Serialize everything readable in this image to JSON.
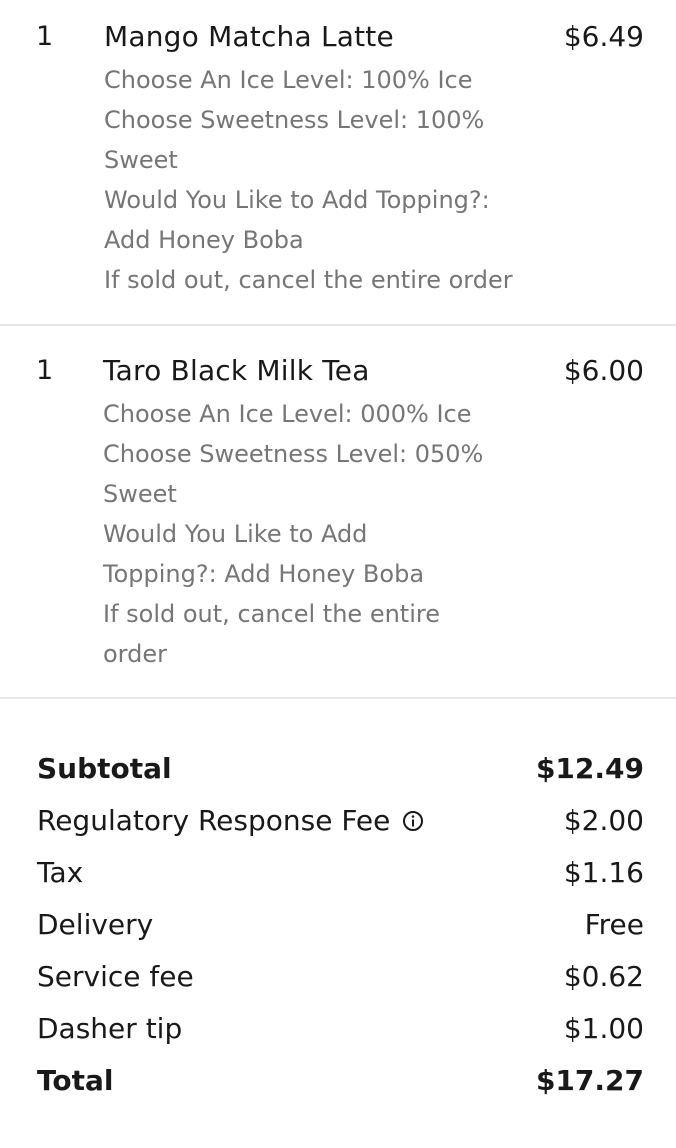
{
  "items": [
    {
      "quantity": "1",
      "name": "Mango Matcha Latte",
      "price": "$6.49",
      "options": [
        "Choose An Ice Level: 100% Ice",
        "Choose Sweetness Level: 100%",
        "Sweet",
        "Would You Like to Add Topping?:",
        "Add Honey Boba",
        "If sold out, cancel the entire order"
      ]
    },
    {
      "quantity": "1",
      "name": "Taro Black Milk Tea",
      "price": "$6.00",
      "options": [
        "Choose An Ice Level: 000% Ice",
        "Choose Sweetness Level: 050%",
        "Sweet",
        "Would You Like to Add",
        "Topping?: Add Honey Boba",
        "If sold out, cancel the entire",
        "order"
      ]
    }
  ],
  "summary": {
    "subtotal": {
      "label": "Subtotal",
      "value": "$12.49"
    },
    "regulatory_fee": {
      "label": "Regulatory Response Fee",
      "value": "$2.00",
      "icon": "info-icon"
    },
    "tax": {
      "label": "Tax",
      "value": "$1.16"
    },
    "delivery": {
      "label": "Delivery",
      "value": "Free"
    },
    "service_fee": {
      "label": "Service fee",
      "value": "$0.62"
    },
    "dasher_tip": {
      "label": "Dasher tip",
      "value": "$1.00"
    },
    "total": {
      "label": "Total",
      "value": "$17.27"
    }
  },
  "colors": {
    "text": "#191919",
    "secondary_text": "#767676",
    "divider": "#e6e6e6"
  }
}
